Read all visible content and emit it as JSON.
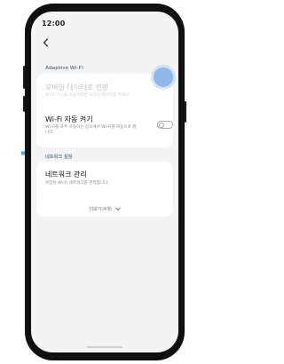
{
  "colors": {
    "arrow": "#46a6e6",
    "highlight": "#8fb8e8",
    "screen_bg": "#f4f4f4",
    "card_bg": "#ffffff",
    "section_label": "#7a8a99"
  },
  "icons": {
    "arrow": "right-pointing-arrow-icon",
    "back": "back-chevron-icon",
    "expand": "chevron-down-icon"
  },
  "status_bar": {
    "time": "12:00"
  },
  "adaptive_wifi": {
    "label": "Adaptive Wi-Fi",
    "mobile_data_switch": {
      "title": "모바일 데이터로 전환",
      "subtitle": "Wi-Fi 기능을 사용하려면 모바일 데이터를 켜세요.",
      "enabled": false
    },
    "auto_wifi": {
      "title": "Wi-Fi 자동 켜기",
      "subtitle": "Wi-Fi를 자주 사용하는 장소에서 Wi-Fi를 자동으로 켭니다.",
      "toggle_on": false
    }
  },
  "network_settings": {
    "label": "네트워크 설정",
    "manage": {
      "title": "네트워크 관리",
      "subtitle": "저장된 Wi-Fi 네트워크를 관리합니다."
    },
    "more_label": "더보기(4개)"
  }
}
